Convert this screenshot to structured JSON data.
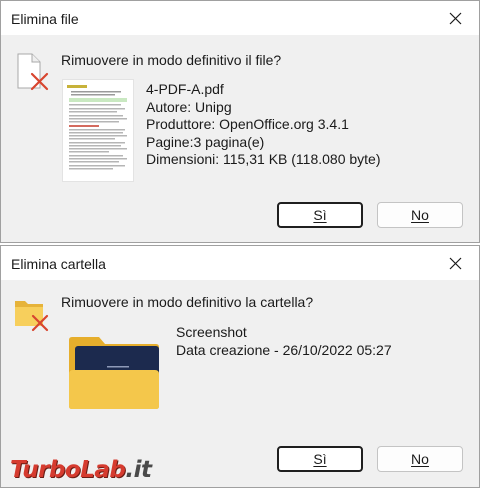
{
  "delete_file_dialog": {
    "title": "Elimina file",
    "prompt": "Rimuovere in modo definitivo il file?",
    "file_info": [
      "4-PDF-A.pdf",
      "Autore: Unipg",
      "Produttore: OpenOffice.org 3.4.1",
      "Pagine:3 pagina(e)",
      "Dimensioni: 115,31 KB (118.080 byte)"
    ],
    "yes_label": "Sì",
    "no_label": "No"
  },
  "delete_folder_dialog": {
    "title": "Elimina cartella",
    "prompt": "Rimuovere in modo definitivo la cartella?",
    "folder_info": [
      "Screenshot",
      "Data creazione - 26/10/2022 05:27"
    ],
    "yes_label": "Sì",
    "no_label": "No"
  },
  "watermark": {
    "brand": "TurboLab",
    "suffix": ".it"
  },
  "colors": {
    "accent_red": "#d63b2f",
    "folder_yellow": "#f4c74b",
    "folder_navy": "#1c2a4e"
  },
  "icons": [
    "close-icon",
    "delete-file-icon",
    "delete-folder-icon",
    "pdf-thumbnail",
    "folder-icon"
  ]
}
